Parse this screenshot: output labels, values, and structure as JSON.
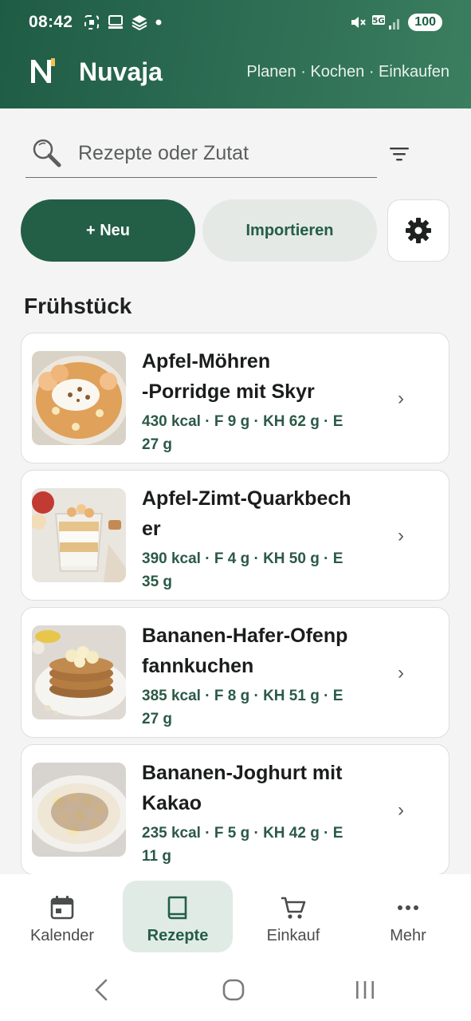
{
  "status_bar": {
    "time": "08:42",
    "battery": "100",
    "network": "5G"
  },
  "header": {
    "app_title": "Nuvaja",
    "nav": "Planen · Kochen · Einkaufen"
  },
  "search": {
    "placeholder": "Rezepte oder Zutat"
  },
  "actions": {
    "new_label": "+ Neu",
    "import_label": "Importieren"
  },
  "section": {
    "title": "Frühstück"
  },
  "recipes": [
    {
      "title_line1": "Apfel-Möhren",
      "title_line2": "-Porridge mit Skyr",
      "meta_line1": "430 kcal · F 9 g · KH 62 g · E",
      "meta_line2": "27 g"
    },
    {
      "title_line1": "Apfel-Zimt-Quarkbech",
      "title_line2": "er",
      "meta_line1": "390 kcal · F 4 g · KH 50 g · E",
      "meta_line2": "35 g"
    },
    {
      "title_line1": "Bananen-Hafer-Ofenp",
      "title_line2": "fannkuchen",
      "meta_line1": "385 kcal · F 8 g · KH 51 g · E",
      "meta_line2": "27 g"
    },
    {
      "title_line1": "Bananen-Joghurt mit",
      "title_line2": "Kakao",
      "meta_line1": "235 kcal · F 5 g · KH 42 g · E",
      "meta_line2": "11 g"
    }
  ],
  "bottom_nav": [
    {
      "label": "Kalender",
      "icon": "calendar-icon"
    },
    {
      "label": "Rezepte",
      "icon": "book-icon",
      "active": true
    },
    {
      "label": "Einkauf",
      "icon": "cart-icon"
    },
    {
      "label": "Mehr",
      "icon": "more-icon"
    }
  ],
  "colors": {
    "primary": "#235e46",
    "header_start": "#1f5c45",
    "header_end": "#3b7e5f",
    "active_nav_bg": "#e1ebe5"
  }
}
